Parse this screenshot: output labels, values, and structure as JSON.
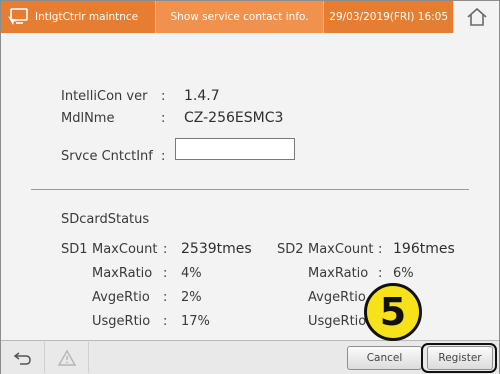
{
  "header": {
    "title": "IntlgtCtrlr maintnce",
    "subtitle": "Show service contact info.",
    "datetime": "29/03/2019(FRI) 16:05",
    "icon": "monitor-cursor-icon",
    "home_icon": "home-icon"
  },
  "info": {
    "ver_label": "IntelliCon ver",
    "ver_value": "1.4.7",
    "model_label": "MdlNme",
    "model_value": "CZ-256ESMC3",
    "contact_label": "Srvce CntctInf",
    "contact_value": "",
    "colon": ":"
  },
  "sdcard": {
    "title": "SDcardStatus",
    "sd1": {
      "name": "SD1",
      "max_count_label": "MaxCount",
      "max_count_value": "2539tmes",
      "max_ratio_label": "MaxRatio",
      "max_ratio_value": "4%",
      "avg_ratio_label": "AvgeRtio",
      "avg_ratio_value": "2%",
      "usage_ratio_label": "UsgeRtio",
      "usage_ratio_value": "17%"
    },
    "sd2": {
      "name": "SD2",
      "max_count_label": "MaxCount",
      "max_count_value": "196tmes",
      "max_ratio_label": "MaxRatio",
      "max_ratio_value": "6%",
      "avg_ratio_label": "AvgeRtio",
      "usage_ratio_label": "UsgeRtio"
    }
  },
  "footer": {
    "back_icon": "back-arrow-icon",
    "warning_icon": "warning-icon",
    "cancel_label": "Cancel",
    "register_label": "Register"
  },
  "callout": {
    "number": "5"
  },
  "colors": {
    "header_orange": "#e57e32",
    "header_light_orange": "#f0924e",
    "callout_yellow": "#f7e11a"
  }
}
